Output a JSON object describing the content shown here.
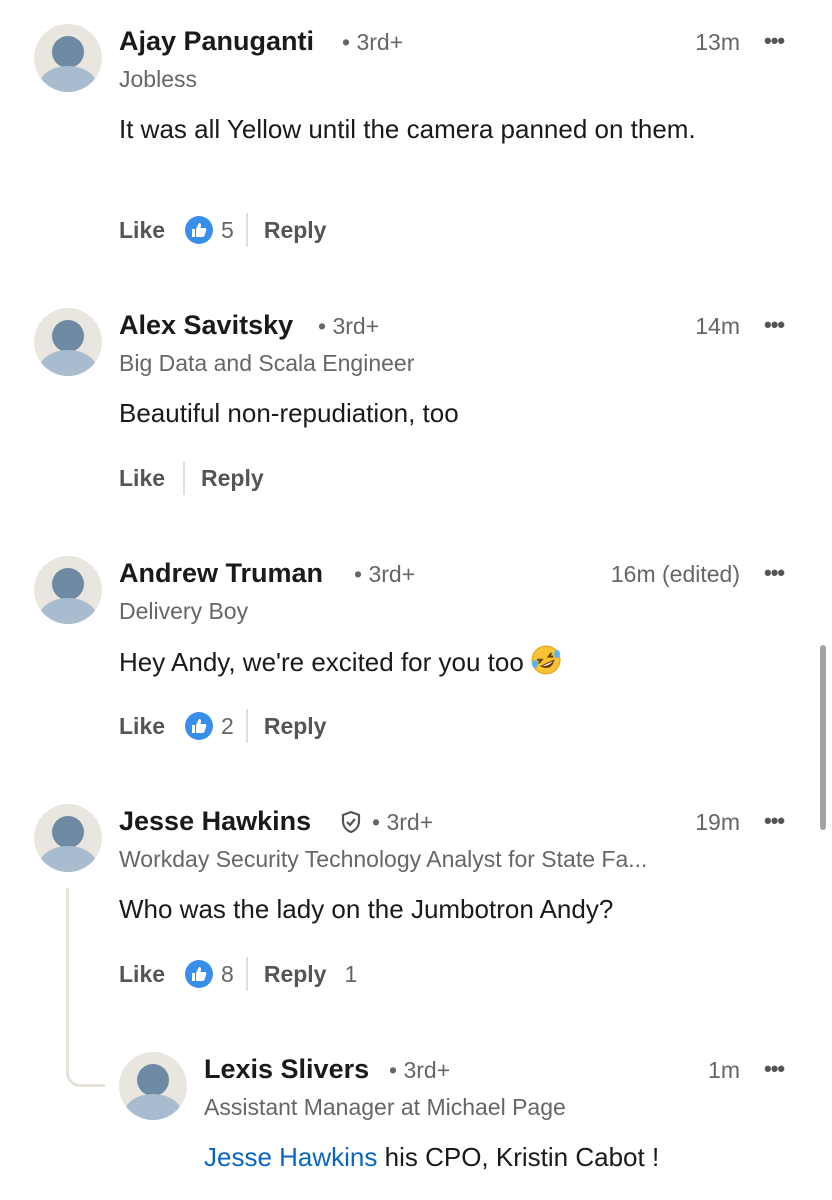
{
  "comments": [
    {
      "name": "Ajay Panuganti",
      "degree": "3rd+",
      "time": "13m",
      "headline": "Jobless",
      "text": "It was all Yellow until the camera panned on them.",
      "like_label": "Like",
      "reaction_count": "5",
      "reply_label": "Reply"
    },
    {
      "name": "Alex Savitsky",
      "degree": "3rd+",
      "time": "14m",
      "headline": "Big Data and Scala Engineer",
      "text": "Beautiful non-repudiation, too",
      "like_label": "Like",
      "reply_label": "Reply"
    },
    {
      "name": "Andrew Truman",
      "degree": "3rd+",
      "time": "16m (edited)",
      "headline": "Delivery Boy",
      "text": "Hey Andy, we're excited for you too",
      "emoji": "rolling-on-floor-laughing",
      "like_label": "Like",
      "reaction_count": "2",
      "reply_label": "Reply"
    },
    {
      "name": "Jesse Hawkins",
      "verified": true,
      "degree": "3rd+",
      "time": "19m",
      "headline": "Workday Security Technology Analyst for State Fa...",
      "text": "Who was the lady on the Jumbotron Andy?",
      "like_label": "Like",
      "reaction_count": "8",
      "reply_label": "Reply",
      "reply_count": "1"
    },
    {
      "name": "Lexis Slivers",
      "degree": "3rd+",
      "time": "1m",
      "headline": "Assistant Manager at Michael Page",
      "mention": "Jesse Hawkins",
      "text": " his CPO, Kristin Cabot !"
    }
  ],
  "ui": {
    "degree_separator": "•",
    "more_icon": "…",
    "like_icon_color": "#378fe9",
    "mention_color": "#0a66c2"
  }
}
